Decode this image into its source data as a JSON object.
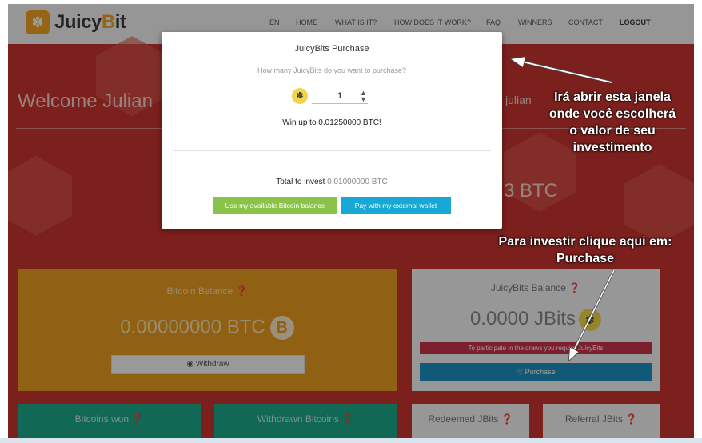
{
  "nav": {
    "logo_prefix": "Juicy",
    "logo_b": "B",
    "logo_suffix": "it",
    "items": [
      "EN",
      "HOME",
      "WHAT IS IT?",
      "HOW DOES IT WORK?",
      "FAQ",
      "WINNERS",
      "CONTACT",
      "LOGOUT"
    ]
  },
  "hero": {
    "welcome": "Welcome Julian",
    "user_right": "julian",
    "btc_right": "3 BTC"
  },
  "bitcoin_card": {
    "title": "Bitcoin Balance",
    "balance": "0.00000000 BTC",
    "coin_glyph": "B",
    "withdraw_label": "Withdraw"
  },
  "jbits_card": {
    "title": "JuicyBits Balance",
    "balance": "0.0000 JBits",
    "warning": "To participate in the draws you require JuicyBits",
    "purchase_label": "Purchase"
  },
  "bottom_cards": {
    "bitcoins_won": "Bitcoins won",
    "withdrawn": "Withdrawn Bitcoins",
    "redeemed": "Redeemed JBits",
    "referral": "Referral JBits"
  },
  "modal": {
    "title": "JuicyBits Purchase",
    "question": "How many JuicyBits do you want to purchase?",
    "quantity": "1",
    "win_text": "Win up to 0.01250000 BTC!",
    "total_label": "Total to invest",
    "total_amount": "0.01000000 BTC",
    "btn_balance": "Use my available Bitcoin balance",
    "btn_wallet": "Pay with my external wallet"
  },
  "annotations": {
    "window_line1": "Irá abrir esta janela",
    "window_line2": "onde você escolherá",
    "window_line3": "o valor de seu",
    "window_line4": "investimento",
    "purchase_line1": "Para investir clique aqui em:",
    "purchase_line2": "Purchase"
  },
  "colors": {
    "hero_red": "#c8352f",
    "bitcoin_orange": "#e89b20",
    "teal": "#1aa88a",
    "green_button": "#8bc34a",
    "blue_button": "#17a8d6",
    "purchase_blue": "#1e8fc0",
    "warning_red": "#c9324b"
  }
}
